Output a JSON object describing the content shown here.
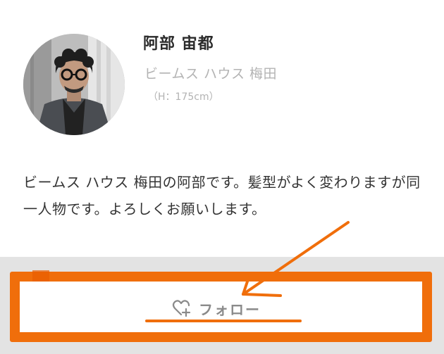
{
  "profile": {
    "name": "阿部 宙都",
    "shop": "ビームス ハウス 梅田",
    "height": "（H：175cm）",
    "avatar_icon": "staff-photo"
  },
  "bio": {
    "text": "ビームス ハウス 梅田の阿部です。髪型がよく変わりますが同一人物です。よろしくお願いします。"
  },
  "follow": {
    "label": "フォロー",
    "icon": "heart-plus-icon"
  },
  "annotation": {
    "color": "#f06e0b"
  }
}
